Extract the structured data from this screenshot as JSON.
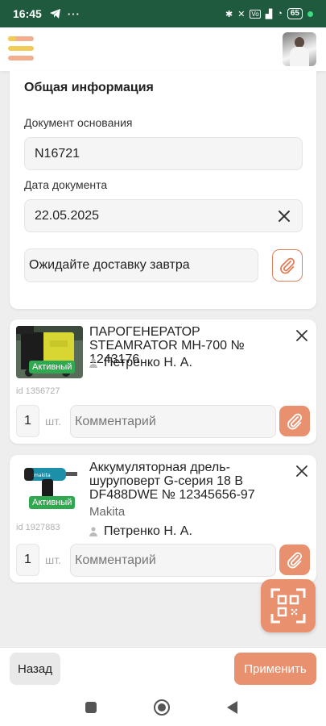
{
  "status": {
    "time": "16:45",
    "battery": "65",
    "left_icons": [
      "telegram-icon",
      "more-icon"
    ],
    "right_icons": [
      "bluetooth-icon",
      "mute-icon",
      "vowifi-icon",
      "signal-icon",
      "wifi-icon",
      "battery-icon"
    ]
  },
  "header": {
    "menu_icon": "hamburger-icon",
    "avatar": "user-avatar"
  },
  "general": {
    "title": "Общая информация",
    "doc_basis_label": "Документ основания",
    "doc_basis_value": "N16721",
    "doc_date_label": "Дата документа",
    "doc_date_value": "22.05.2025",
    "note_value": "Ожидайте доставку завтра"
  },
  "items": [
    {
      "title": "ПАРОГЕНЕРАТОР STEAMRATOR МН-700 № 1243176",
      "status": "Активный",
      "id": "id 1356727",
      "person": "Петренко Н. А.",
      "qty": "1",
      "unit": "шт.",
      "comment_placeholder": "Комментарий"
    },
    {
      "title": "Аккумуляторная дрель-шуруповерт G-серия 18 В DF488DWE № 12345656-97",
      "status": "Активный",
      "id": "id 1927883",
      "brand": "Makita",
      "person": "Петренко Н. А.",
      "qty": "1",
      "unit": "шт.",
      "comment_placeholder": "Комментарий"
    }
  ],
  "actions": {
    "back": "Назад",
    "apply": "Применить"
  },
  "colors": {
    "status_bar": "#1f5a3e",
    "accent": "#e9906f",
    "badge_active": "#2fa84f"
  }
}
